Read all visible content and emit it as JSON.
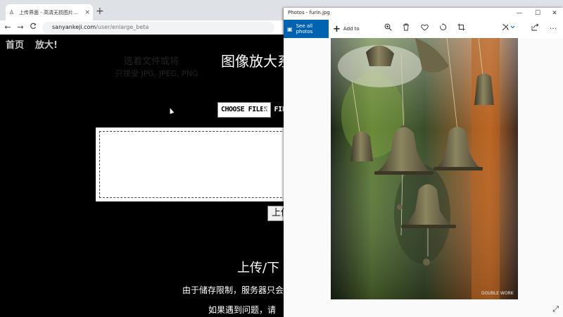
{
  "browser": {
    "tab": {
      "title": "上传界面 - 高清无损图片放大 - Sa",
      "close": "×"
    },
    "new_tab": "+",
    "nav": {
      "back": "←",
      "forward": "→",
      "reload": "C"
    },
    "url": {
      "domain": "sanyankeji.com",
      "path": "/user/enlarge_beta"
    }
  },
  "page": {
    "nav_links": [
      "首页",
      "放大!"
    ],
    "title": "图像放大系",
    "choose_files": "CHOOSE FILES",
    "no_file": "NO FILE",
    "drop_line1": "选着文件或将",
    "drop_line2": "只接受 JPG, JPEG, PNG",
    "upload_button": "上传",
    "section_title": "上传/下",
    "limit_text": "由于储存限制，服务器只会",
    "problem_text": "如果遇到问题，请"
  },
  "photos": {
    "window_title": "Photos - furin.jpg",
    "controls": {
      "minimize": "—",
      "maximize": "☐",
      "close": "✕"
    },
    "see_all": "See all photos",
    "add_to": "Add to",
    "watermark": "DOUBLE WORK",
    "colors": {
      "accent": "#0063b1"
    }
  }
}
